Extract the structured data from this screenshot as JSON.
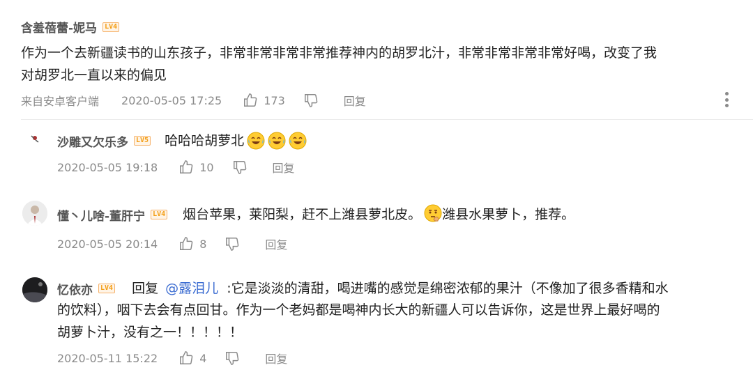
{
  "main_comment": {
    "username": "含羞蓓蕾-妮马",
    "level": "LV4",
    "text_line1": "作为一个去新疆读书的山东孩子，非常非常非常非常推荐神内的胡罗北汁，非常非常非常非常好喝，改变了我",
    "text_line2": "对胡罗北一直以来的偏见",
    "source": "来自安卓客户端",
    "timestamp": "2020-05-05 17:25",
    "likes": "173",
    "reply_label": "回复"
  },
  "replies": [
    {
      "username": "沙雕又欠乐多",
      "level": "LV5",
      "text": "哈哈哈胡萝北",
      "emojis": [
        "laughing-tears-emoji",
        "laughing-tears-emoji",
        "laughing-tears-emoji"
      ],
      "timestamp": "2020-05-05 19:18",
      "likes": "10",
      "reply_label": "回复"
    },
    {
      "username": "懂丶儿啥-董肝宁",
      "level": "LV4",
      "text_before": "烟台苹果，莱阳梨，赶不上潍县萝北皮。",
      "text_after": "潍县水果萝卜，推荐。",
      "emoji": "thinking-face-emoji",
      "timestamp": "2020-05-05 20:14",
      "likes": "8",
      "reply_label": "回复"
    },
    {
      "username": "忆依亦",
      "level": "LV4",
      "reply_prefix": "回复",
      "mention": "@露泪儿",
      "text_line1": ":它是淡淡的清甜，喝进嘴的感觉是绵密浓郁的果汁（不像加了很多香精和水",
      "text_line2": "的饮料），咽下去会有点回甘。作为一个老妈都是喝神内长大的新疆人可以告诉你，这是世界上最好喝的",
      "text_line3": "胡萝卜汁，没有之一！！！！！",
      "timestamp": "2020-05-11 15:22",
      "likes": "4",
      "reply_label": "回复"
    }
  ],
  "colors": {
    "level_badge": "#f39c12",
    "mention": "#3a6bd1",
    "meta": "#8a8a8a"
  }
}
